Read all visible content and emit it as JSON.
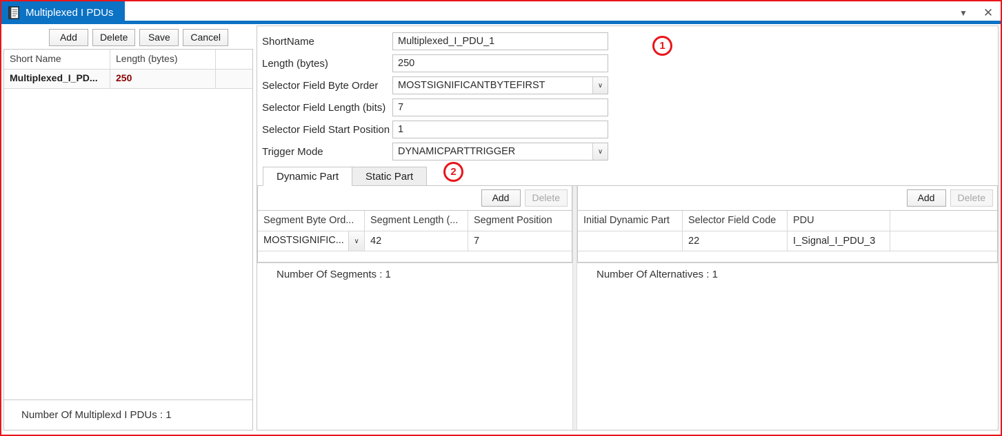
{
  "window": {
    "tab_title": "Multiplexed I PDUs",
    "tab_icon": "document-icon",
    "dropdown_icon": "▼",
    "close_icon": "✕",
    "accent_color": "#0b72c4",
    "annotation_color": "#e8151a"
  },
  "annotations": [
    {
      "label": "1"
    },
    {
      "label": "2"
    }
  ],
  "left_panel": {
    "toolbar": {
      "add_label": "Add",
      "delete_label": "Delete",
      "save_label": "Save",
      "cancel_label": "Cancel"
    },
    "table": {
      "headers": [
        "Short Name",
        "Length (bytes)",
        ""
      ],
      "rows": [
        {
          "short_name": "Multiplexed_I_PD...",
          "length": "250",
          "extra": ""
        }
      ]
    },
    "status": "Number Of Multiplexd I PDUs : 1"
  },
  "form": {
    "fields": [
      {
        "label": "ShortName",
        "value": "Multiplexed_I_PDU_1",
        "type": "text"
      },
      {
        "label": "Length (bytes)",
        "value": "250",
        "type": "text"
      },
      {
        "label": "Selector Field Byte Order",
        "value": "MOSTSIGNIFICANTBYTEFIRST",
        "type": "select"
      },
      {
        "label": "Selector Field Length (bits)",
        "value": "7",
        "type": "text"
      },
      {
        "label": "Selector Field Start Position",
        "value": "1",
        "type": "text"
      },
      {
        "label": "Trigger Mode",
        "value": "DYNAMICPARTTRIGGER",
        "type": "select"
      }
    ],
    "select_arrow_icon": "∨"
  },
  "tabs": [
    {
      "label": "Dynamic Part",
      "active": true
    },
    {
      "label": "Static Part",
      "active": false
    }
  ],
  "segments_panel": {
    "toolbar": {
      "add_label": "Add",
      "delete_label": "Delete",
      "delete_disabled": true
    },
    "headers": [
      "Segment Byte Ord...",
      "Segment Length (...",
      "Segment Position",
      ""
    ],
    "rows": [
      {
        "byte_order": "MOSTSIGNIFIC...",
        "length": "42",
        "position": "7",
        "extra": ""
      }
    ],
    "status": "Number Of Segments : 1",
    "combo_arrow_icon": "∨"
  },
  "alternatives_panel": {
    "toolbar": {
      "add_label": "Add",
      "delete_label": "Delete",
      "delete_disabled": true
    },
    "headers": [
      "Initial Dynamic Part",
      "Selector Field Code",
      "PDU",
      ""
    ],
    "rows": [
      {
        "initial_dynamic_part": "",
        "selector_field_code": "22",
        "pdu": "I_Signal_I_PDU_3",
        "extra": ""
      }
    ],
    "status": "Number Of Alternatives : 1"
  }
}
